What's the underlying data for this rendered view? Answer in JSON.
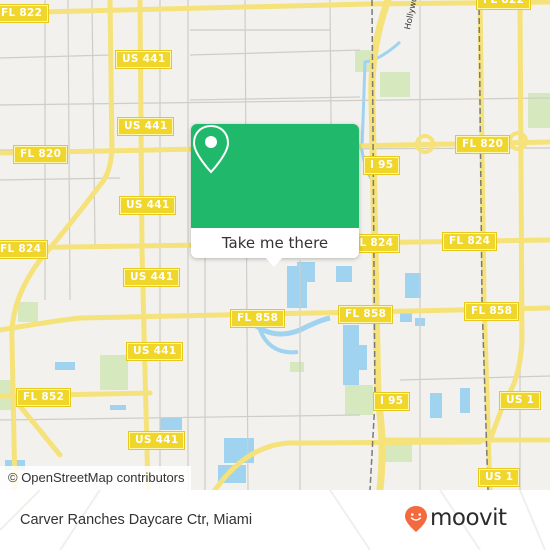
{
  "map": {
    "attribution": "© OpenStreetMap contributors",
    "colors": {
      "background": "#f2f1ed",
      "road_major": "#f5e27a",
      "road_minor": "#cfcdc8",
      "water": "#9fd3ef",
      "park": "#d6e8bd",
      "rail": "#7a7a7a"
    },
    "road_labels": [
      {
        "id": "fl822-left",
        "text": "FL 822"
      },
      {
        "id": "fl822-right",
        "text": "FL 822"
      },
      {
        "id": "us441-a",
        "text": "US 441"
      },
      {
        "id": "us441-b",
        "text": "US 441"
      },
      {
        "id": "fl820-left",
        "text": "FL 820"
      },
      {
        "id": "fl820-right",
        "text": "FL 820"
      },
      {
        "id": "i95-a",
        "text": "I 95"
      },
      {
        "id": "us441-c",
        "text": "US 441"
      },
      {
        "id": "fl824-left",
        "text": "FL 824"
      },
      {
        "id": "fl824-mid",
        "text": "FL 824"
      },
      {
        "id": "fl824-right",
        "text": "FL 824"
      },
      {
        "id": "us441-d",
        "text": "US 441"
      },
      {
        "id": "fl858-left",
        "text": "FL 858"
      },
      {
        "id": "fl858-mid",
        "text": "FL 858"
      },
      {
        "id": "fl858-right",
        "text": "FL 858"
      },
      {
        "id": "us441-e",
        "text": "US 441"
      },
      {
        "id": "fl852",
        "text": "FL 852"
      },
      {
        "id": "i95-b",
        "text": "I 95"
      },
      {
        "id": "us1-a",
        "text": "US 1"
      },
      {
        "id": "us441-f",
        "text": "US 441"
      },
      {
        "id": "us1-b",
        "text": "US 1"
      }
    ],
    "street_label": "Hollywood",
    "popup": {
      "button_label": "Take me there",
      "icon": "location-pin-icon",
      "color": "#20b96b"
    }
  },
  "footer": {
    "place_name": "Carver Ranches Daycare Ctr, Miami",
    "brand": "moovit",
    "brand_icon": "moovit-smiley-pin-icon",
    "brand_color": "#f26a3d"
  }
}
